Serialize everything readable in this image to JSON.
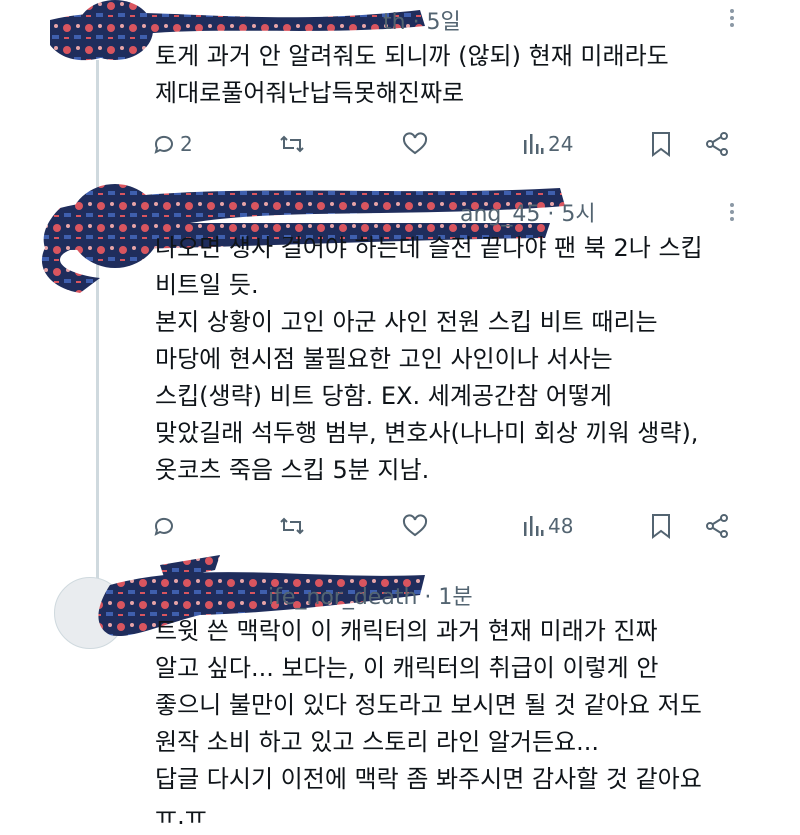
{
  "posts": [
    {
      "time_fragment": "th · 5일",
      "text": "토게 과거 안 알려줘도 되니까 (않되) 현재 미래라도\n제대로풀어줘난납득못해진짜로",
      "replies": "2",
      "views": "24",
      "icons": [
        "comment-icon",
        "repost-icon",
        "like-icon",
        "views-icon",
        "bookmark-icon",
        "share-icon"
      ]
    },
    {
      "time_fragment": "ang_45 · 5시",
      "text": "나오면 생사 걸어야 하는데 슬전 끝나야 팬 북 2나 스킵\n비트일 듯.\n본지 상황이 고인 아군 사인 전원 스킵 비트 때리는\n마당에 현시점 불필요한 고인 사인이나 서사는\n스킵(생략) 비트 당함. EX. 세계공간참 어떻게\n맞았길래 석두행 범부, 변호사(나나미 회상 끼워 생략),\n옷코츠 죽음 스킵 5분 지남.",
      "replies": "",
      "views": "48"
    },
    {
      "time_fragment": "ife_nor_death · 1분",
      "text": "트윗 쓴 맥락이 이 캐릭터의 과거 현재 미래가 진짜\n알고 싶다... 보다는, 이 캐릭터의 취급이 이렇게 안\n좋으니 불만이 있다 정도라고 보시면 될 것 같아요 저도\n원작 소비 하고 있고 스토리 라인 알거든요...\n답글 다시기 이전에 맥락 좀 봐주시면 감사할 것 같아요\nㅠ.ㅠ"
    }
  ],
  "colors": {
    "text": "#0f1419",
    "muted": "#536471",
    "thread_line": "#cfd9de",
    "scribble_navy": "#1f2d5c",
    "scribble_red": "#d9555f"
  }
}
